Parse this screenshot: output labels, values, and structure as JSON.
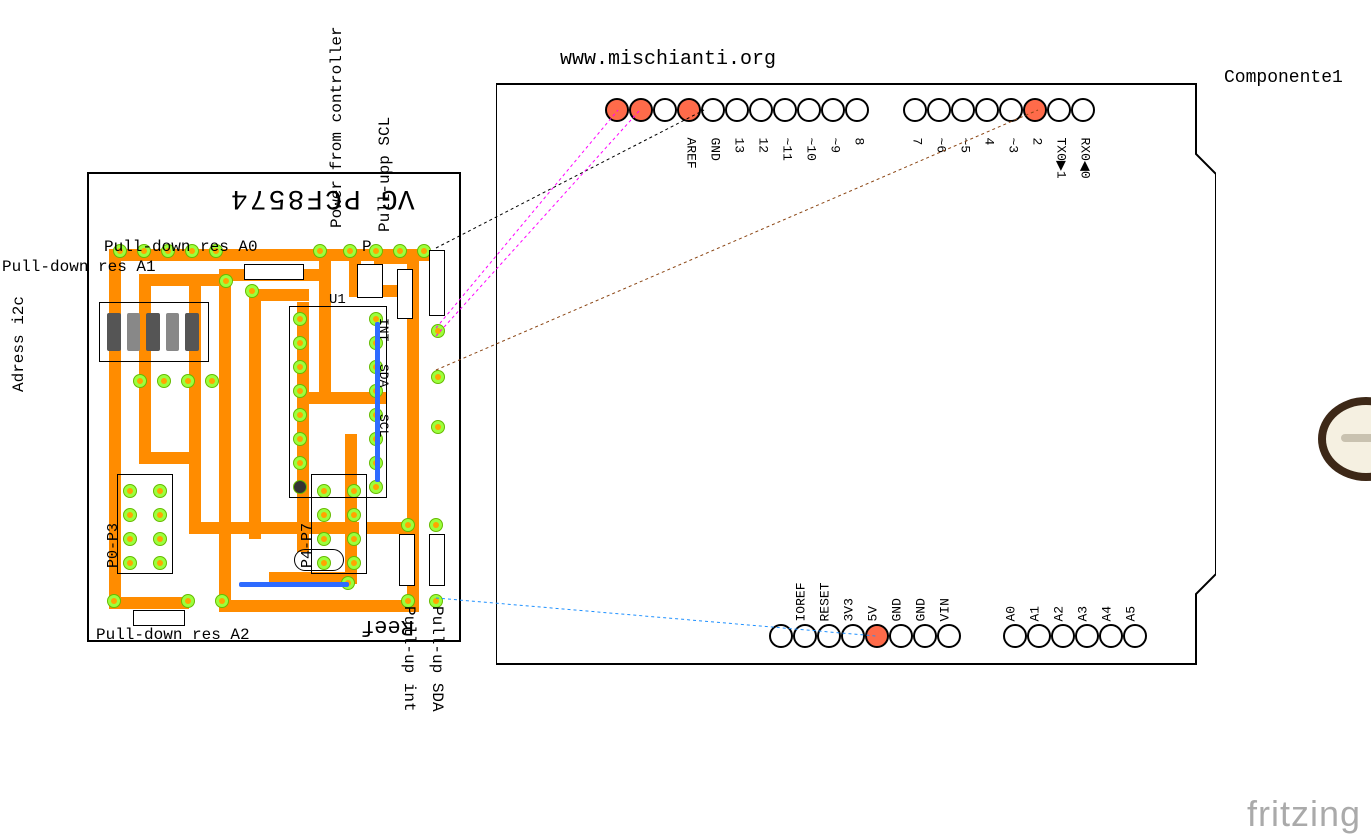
{
  "website_url": "www.mischianti.org",
  "component_ref": "Componente1",
  "watermark": "fritzing",
  "pcb_module": {
    "chip_ref": "U1",
    "chip_name": "PCF8574",
    "labels": {
      "address_i2c": "Adress i2c",
      "pull_down_a0": "Pull-down res A0",
      "pull_down_a1": "Pull-down res A1",
      "pull_down_a2": "Pull-down res A2",
      "power_from_controller": "Power from controller",
      "pull_up_scl": "Pull-upp SCL",
      "pull_up_sda": "Pull-up SDA",
      "pull_up_int": "Pull-up int",
      "p0_p3": "P0-P3",
      "p4_p7": "P4-P7",
      "int": "INT",
      "sda": "SDA",
      "scl": "SCL",
      "reef": "Reef",
      "vg": "VG"
    }
  },
  "arduino": {
    "top_row_left": [
      "",
      "",
      "",
      "AREF",
      "GND",
      "13",
      "12",
      "~11",
      "~10",
      "~9",
      "8"
    ],
    "top_row_right": [
      "7",
      "~6",
      "~5",
      "4",
      "~3",
      "2",
      "TX0▶1",
      "RX0◀0"
    ],
    "bottom_row_power_labels": [
      "",
      "IOREF",
      "RESET",
      "3V3",
      "5V",
      "GND",
      "GND",
      "VIN"
    ],
    "bottom_row_analog_labels": [
      "A0",
      "A1",
      "A2",
      "A3",
      "A4",
      "A5"
    ]
  },
  "wires": [
    {
      "from": "pcb.gnd_pad",
      "to": "arduino.gnd",
      "color": "#000",
      "desc": "GND wire"
    },
    {
      "from": "pcb.int",
      "to": "arduino.top_pin1",
      "color": "#ff00ff",
      "desc": "INT wire"
    },
    {
      "from": "pcb.sda",
      "to": "arduino.top_pin0",
      "color": "#ff00ff",
      "desc": "SDA wire"
    },
    {
      "from": "pcb.scl",
      "to": "arduino.d2",
      "color": "#8b4513",
      "desc": "SCL wire"
    },
    {
      "from": "pcb.5v",
      "to": "arduino.5v",
      "color": "#1e90ff",
      "desc": "5V wire"
    }
  ],
  "colors": {
    "pcb_trace": "#ff8c00",
    "pcb_pad": "#9bff3d",
    "highlight_pin": "#ff6b4a",
    "bee_brown": "#3d2817",
    "bee_yellow": "#f5b934",
    "bee_cream": "#f5f0e1"
  }
}
